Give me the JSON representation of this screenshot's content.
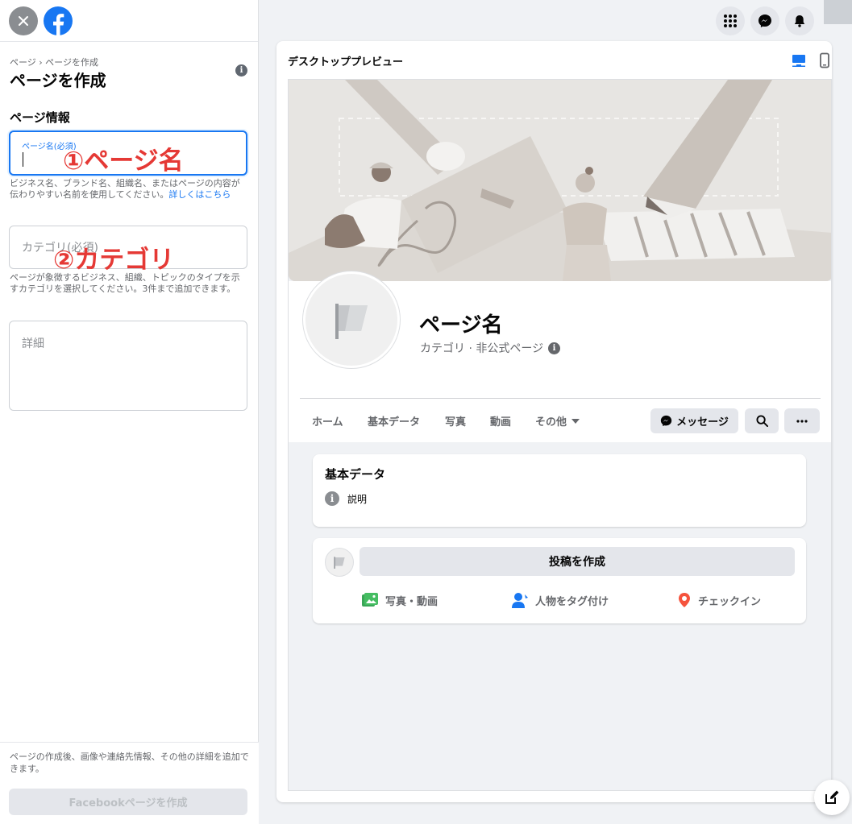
{
  "left": {
    "breadcrumb": "ページ › ページを作成",
    "title": "ページを作成",
    "section_title": "ページ情報",
    "page_name_field": {
      "label": "ページ名(必須)",
      "value": ""
    },
    "page_name_helper": "ビジネス名、ブランド名、組織名、またはページの内容が伝わりやすい名前を使用してください。",
    "page_name_helper_link": "詳しくはこちら",
    "category_field": {
      "placeholder": "カテゴリ(必須)"
    },
    "category_helper": "ページが象徴するビジネス、組織、トピックのタイプを示すカテゴリを選択してください。3件まで追加できます。",
    "details_field": {
      "placeholder": "詳細"
    },
    "bottom_note": "ページの作成後、画像や連絡先情報、その他の詳細を追加できます。",
    "create_button": "Facebookページを作成"
  },
  "annotations": {
    "page_name": "①ページ名",
    "category": "②カテゴリ"
  },
  "preview": {
    "label": "デスクトッププレビュー",
    "page_name": "ページ名",
    "page_sub": "カテゴリ · 非公式ページ",
    "tabs": [
      "ホーム",
      "基本データ",
      "写真",
      "動画",
      "その他"
    ],
    "message_button": "メッセージ",
    "about_card": {
      "title": "基本データ",
      "description": "説明"
    },
    "post_card": {
      "create_post": "投稿を作成",
      "actions": [
        "写真・動画",
        "人物をタグ付け",
        "チェックイン"
      ]
    }
  },
  "icons": {
    "close": "close-icon",
    "logo": "facebook-logo-icon",
    "apps": "apps-grid-icon",
    "messenger": "messenger-icon",
    "notifications": "bell-icon",
    "desktop": "desktop-icon",
    "mobile": "mobile-icon",
    "edit": "compose-icon"
  },
  "colors": {
    "brand": "#1877f2",
    "annotation": "#e53935",
    "photo_green": "#45bd62",
    "tag_blue": "#1877f2",
    "checkin_red": "#f5533d"
  }
}
